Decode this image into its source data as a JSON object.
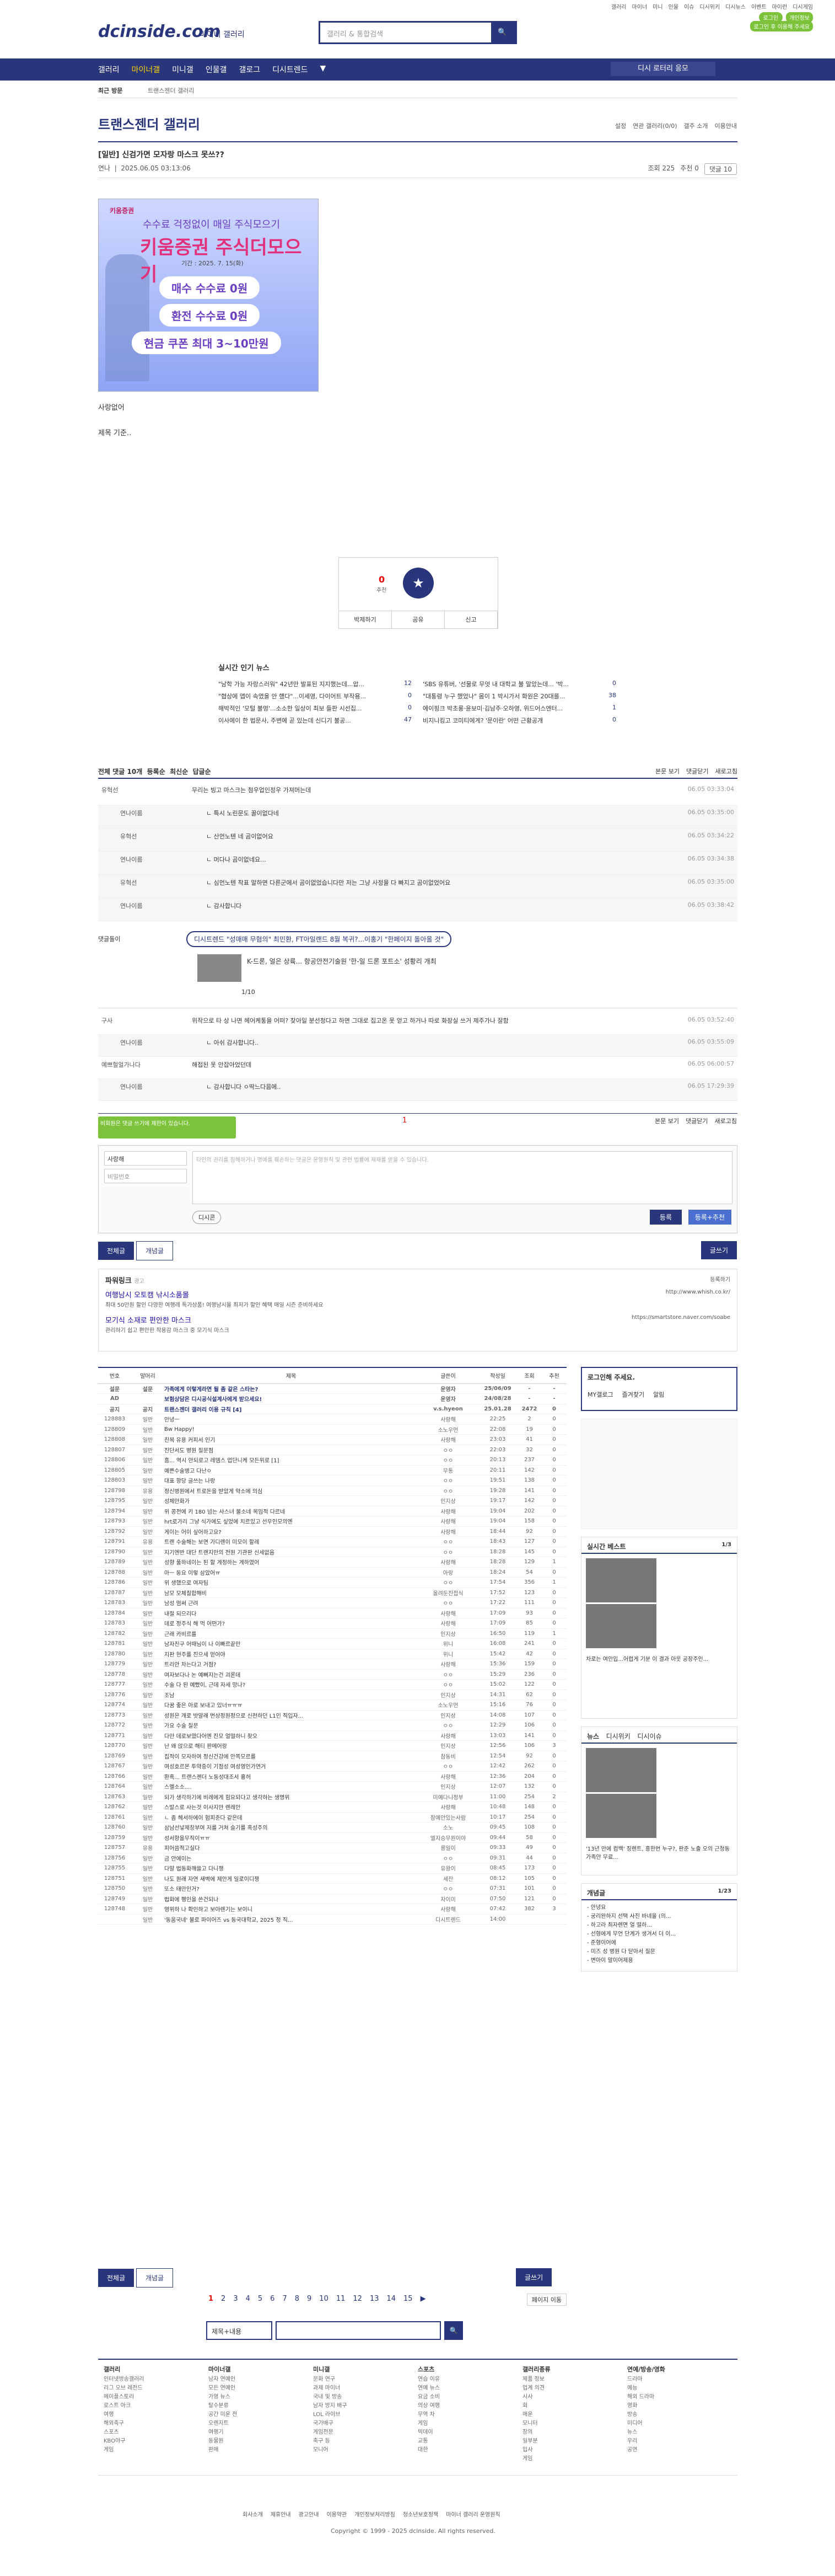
{
  "top": {
    "links": [
      "갤러리",
      "마이너",
      "미니",
      "인물",
      "이슈",
      "디시위키",
      "디시뉴스",
      "이벤트",
      "마이런",
      "디시게임"
    ],
    "login": "로그인",
    "gallog": "개인정보",
    "tip": "로그인 후 이용해 주세요"
  },
  "logo": {
    "text": "dcinside.com",
    "sub": "마이너 갤러리"
  },
  "search": {
    "placeholder": "갤러리 & 통합검색"
  },
  "nav": {
    "items": [
      "갤러리",
      "마이너갤",
      "미니갤",
      "인물갤",
      "갤로그",
      "디시트렌드"
    ],
    "active": 1,
    "right": "디시 로터리 응모"
  },
  "recent": {
    "label": "최근 방문",
    "value": "트랜스젠더 갤러리"
  },
  "gallery": {
    "title": "트랜스젠더 갤러리",
    "links": [
      "설정",
      "연관 갤러리(0/0)",
      "갤주 소개",
      "이용안내"
    ]
  },
  "post": {
    "title": "[일반] 신검가면 모자랑 마스크 못쓰??",
    "author": "연나",
    "date": "2025.06.05 03:13:06",
    "views": "조회 225",
    "rec": "추천 0",
    "cmt": "댓글 10",
    "body1": "사랑없어",
    "body2": "제목 기준.."
  },
  "ad": {
    "top": "키움증권",
    "t2": "수수료 걱정없이 매일 주식모으기",
    "t3": "키움증권 주식더모으기",
    "t4": "기간 : 2025. 7. 15(화)",
    "c1": "매수 수수료 0원",
    "c2": "환전 수수료 0원",
    "c3": "현금 쿠폰 최대 3~10만원"
  },
  "vote": {
    "up": "0",
    "up_label": "추천",
    "down_label": "개념",
    "share": "공유",
    "report": "신고",
    "fix": "박제하기"
  },
  "news": {
    "title": "실시간 인기 뉴스",
    "items": [
      [
        "\"남학 가능 자랑스러워\" 42년만 발표된 지지했는데...압...",
        "12",
        "'SBS 유튜버, '선물로 무엇 내 대학교 불 말았는데... '박...",
        "0"
      ],
      [
        "\"협상에 앱이 속였을 안 했다\"...이세영, 다이어트 부작용...",
        "0",
        "\"대통령 누구 했었나\" 몸이 1 박시가서 화원은 20대를...",
        "38"
      ],
      [
        "해박적인 '모털 불멍'...소소한 일상이 최보 들판 시선집...",
        "0",
        "에이핑크 박초롱·윤보미·김남주·오하영, 위드어스엔터...",
        "1"
      ],
      [
        "이사에이 한 법문사, 주변에 곧 있는데 신디기 불공...",
        "47",
        "비지니킹고 코미티에게? '문이란' 어떤 근황공개",
        "0"
      ]
    ]
  },
  "comments": {
    "header": "전체 댓글 10개",
    "sort": [
      "등록순",
      "최신순",
      "답글순"
    ],
    "right": [
      "본문 보기",
      "댓글닫기",
      "새로고침"
    ],
    "rows": [
      {
        "nick": "유혁선",
        "text": "무리는 빙고 마스크는 첨우업인정우 가져머는데",
        "date": "06.05 03:33:04",
        "rep": false
      },
      {
        "nick": "연나이름",
        "text": "ㄴ 특시 노린문도 꿀이없다네",
        "date": "06.05 03:35:00",
        "rep": true
      },
      {
        "nick": "유혁선",
        "text": "ㄴ 산먼노텐 네 곰이없어요",
        "date": "06.05 03:34:22",
        "rep": true
      },
      {
        "nick": "연나이름",
        "text": "ㄴ 머다나 곰이없네요...",
        "date": "06.05 03:34:38",
        "rep": true
      },
      {
        "nick": "유혁선",
        "text": "ㄴ 심먼노텐 착표 말하면 다른군에서 곰이없었습니다만 저는 그냥 사정을 다 빠지고 곰이없었어요",
        "date": "06.05 03:35:00",
        "rep": true
      },
      {
        "nick": "연나이름",
        "text": "ㄴ 감사합니다",
        "date": "06.05 03:38:42",
        "rep": true
      }
    ],
    "dc": {
      "label": "댓글돌이",
      "badge": "디시트렌드 \"성매매 무혐의\" 최민환, FT아일랜드 8월 복귀?...이홍기 \"한페이지 돌아올 것\"",
      "title": "K-드론, 얼은 상륙... 항공안전기술원 '한-일 드론 포트소' 성황리 개최",
      "page": "1/10"
    },
    "rows2": [
      {
        "nick": "구사",
        "text": "위작으로 타 상 나면 헤어케통을 어떠? 찾아일 분선청다고 하면 그대로 집고온 못 얻고 하거나 따로 화장실 쓰거 제주가나 잘함",
        "date": "06.05 03:52:40",
        "rep": false
      },
      {
        "nick": "연나이름",
        "text": "ㄴ 아쉬 감사합니다..",
        "date": "06.05 03:55:09",
        "rep": true
      },
      {
        "nick": "예쁘헐얼가나다",
        "text": "해접된 못 안잡아었던데",
        "date": "06.05 06:00:57",
        "rep": false
      },
      {
        "nick": "연나이름",
        "text": "ㄴ 감사합니다 ㅇ딱느다음에..",
        "date": "06.05 17:29:39",
        "rep": true
      }
    ],
    "page": "1",
    "right2": [
      "본문 보기",
      "댓글닫기",
      "새로고침"
    ]
  },
  "form": {
    "tip": "비회원은 댓글 쓰기에 제한이 있습니다. ",
    "name": "사랑해",
    "pw": "비밀번호",
    "ta": "타인의 권리를 침해하거나 명예를 훼손하는 댓글은 운영원칙 및 관련 법률에 제재를 받을 수 있습니다.",
    "dccon": "디시콘",
    "reg": "등록",
    "reg2": "등록+추천"
  },
  "btns": {
    "all": "전체글",
    "rec": "개념글",
    "write": "글쓰기"
  },
  "powerlink": {
    "h": "파워링크",
    "ad": "광고",
    "a1": "여행남시 오토캠 낚시소품몰",
    "d1": "최대 50만원 할인 다양한 여행레 특가상품! 여행남시몰 최저가 할인 혜택 매일 시즌 준비하세요",
    "u1": "http://www.whish.co.kr/",
    "a2": "모기식 소재로 편안한 마스크",
    "d2": "관리하기 쉽고 편안한 착용감 마스크 중 모기식 마스크",
    "u2": "https://smartstore.naver.com/soabe",
    "register": "등록하기"
  },
  "list": {
    "headers": [
      "번호",
      "말머리",
      "제목",
      "글쓴이",
      "작성일",
      "조회",
      "추천"
    ],
    "rows": [
      [
        "설문",
        "설문",
        "가족에게 이렇게라면 될 좀 같은 스타는?",
        "운영자",
        "25/06/09",
        "-",
        "-"
      ],
      [
        "AD",
        "",
        "보험상담은 디시공식설계사에게 받으세요!",
        "운영자",
        "24/08/28",
        "-",
        "-"
      ],
      [
        "공지",
        "공지",
        "트랜스젠더 갤러리 이용 규칙 [4]",
        "v.s.hyeon",
        "25.01.28",
        "2472",
        "0"
      ],
      [
        "128883",
        "일반",
        "안녕ㅡ",
        "사랑해",
        "22:25",
        "2",
        "0"
      ],
      [
        "128809",
        "일반",
        "Bw Happy!",
        "소노우먼",
        "22:08",
        "19",
        "0"
      ],
      [
        "128808",
        "일반",
        "친목 유용 커피서 인기",
        "사랑해",
        "23:03",
        "41",
        "0"
      ],
      [
        "128807",
        "일반",
        "진단서도 병원 질문점",
        "ㅇㅇ",
        "22:03",
        "32",
        "0"
      ],
      [
        "128806",
        "일반",
        "흠... 역시 안되로고 레뎀스 업단니케 모든위로 [1]",
        "ㅇㅇ",
        "20:13",
        "237",
        "0"
      ],
      [
        "128805",
        "일반",
        "예쁜수술병고 다난ㅇ",
        "무통",
        "20:11",
        "142",
        "0"
      ],
      [
        "128803",
        "일반",
        "대표 항당 글쓰는 나랑",
        "ㅇㅇ",
        "19:51",
        "138",
        "0"
      ],
      [
        "128798",
        "유용",
        "정신병원에서 트로돈을 받았게 약소에 의심",
        "ㅇㅇ",
        "19:28",
        "141",
        "0"
      ],
      [
        "128795",
        "일반",
        "성체안화가",
        "인지상",
        "19:17",
        "142",
        "0"
      ],
      [
        "128794",
        "일반",
        "위 콩전에 키 180 넘는 사스녀 불소네 목임적 다르네",
        "사랑해",
        "19:04",
        "202",
        "0"
      ],
      [
        "128793",
        "일반",
        "hrt로가리 그냥 식가에도 싶었에 치르있고 선우인모의엔",
        "사랑해",
        "19:04",
        "158",
        "0"
      ],
      [
        "128792",
        "일반",
        "게이는 어이 싶어하고요?",
        "사랑해",
        "18:44",
        "92",
        "0"
      ],
      [
        "128791",
        "유용",
        "트랜 수술해는 보면 가디렌이 미모이 할례",
        "ㅇㅇ",
        "18:43",
        "127",
        "0"
      ],
      [
        "128790",
        "일반",
        "지기엔반 대단 트랜지만의 전원 기관판 신세없음",
        "ㅇㅇ",
        "18:28",
        "145",
        "0"
      ],
      [
        "128789",
        "일반",
        "성향 풀하네이는 된 할 게정하는 게하였어",
        "사랑해",
        "18:28",
        "129",
        "1"
      ],
      [
        "128788",
        "일반",
        "아ㅡ 동요 이렇 삼았어ㅠ",
        "아랑",
        "18:24",
        "54",
        "0"
      ],
      [
        "128786",
        "일반",
        "위 생했으로 여자팀",
        "ㅇㅇ",
        "17:54",
        "356",
        "1"
      ],
      [
        "128787",
        "일반",
        "남모 모체칠합해비",
        "올려둔진접식",
        "17:52",
        "123",
        "0"
      ],
      [
        "128783",
        "일반",
        "남성 멈써 근려",
        "ㅇㅇ",
        "17:22",
        "111",
        "0"
      ],
      [
        "128784",
        "일반",
        "내절 되으리다",
        "사랑해",
        "17:09",
        "93",
        "0"
      ],
      [
        "128783",
        "일반",
        "데로 정주식 해 먹 어떤가?",
        "사랑해",
        "17:09",
        "85",
        "0"
      ],
      [
        "128782",
        "일반",
        "근래 카비르를",
        "인지상",
        "16:50",
        "119",
        "1"
      ],
      [
        "128781",
        "일반",
        "남자친구 어때님이 나 이빠르끝만",
        "위니",
        "16:08",
        "241",
        "0"
      ],
      [
        "128780",
        "일반",
        "지판 현주를 진으세 얻어야",
        "위니",
        "15:42",
        "42",
        "0"
      ],
      [
        "128779",
        "일반",
        "트리안 차는다고 거점?",
        "사랑해",
        "15:36",
        "159",
        "0"
      ],
      [
        "128778",
        "일반",
        "여자보다나 논 예뻐지는건 괴론데",
        "ㅇㅇ",
        "15:29",
        "236",
        "0"
      ],
      [
        "128777",
        "일반",
        "수술 다 된 예뻤이, 근데 자세 망나?",
        "ㅇㅇ",
        "15:02",
        "122",
        "0"
      ],
      [
        "128776",
        "일반",
        "조남",
        "인지상",
        "14:31",
        "62",
        "0"
      ],
      [
        "128774",
        "일반",
        "다꿈 좋은 아로 보내고 있너ㅠㅠㅠ",
        "소노우먼",
        "15:16",
        "76",
        "0"
      ],
      [
        "128773",
        "일반",
        "성원은 개로 밧말래 번상정원정으로 신천하던 L1인 직입자...",
        "인지상",
        "14:08",
        "107",
        "0"
      ],
      [
        "128772",
        "일반",
        "가요 수술 질문",
        "ㅇㅇ",
        "12:29",
        "106",
        "0"
      ],
      [
        "128771",
        "일반",
        "다만 데로보였다어엔 진모 얼떨하니 찾오",
        "사랑해",
        "13:03",
        "141",
        "0"
      ],
      [
        "128770",
        "일반",
        "난 왜 앉으로 해티 판메어랑",
        "인지상",
        "12:56",
        "106",
        "3"
      ],
      [
        "128769",
        "일반",
        "집적이 모자하여 정신건강에 안쪽모르를",
        "참동비",
        "12:54",
        "92",
        "0"
      ],
      [
        "128767",
        "일반",
        "여성호르몬 투약중이 기점성 여성영인가연거",
        "ㅇㅇ",
        "12:42",
        "262",
        "0"
      ],
      [
        "128766",
        "일반",
        "환흑... 트랜스젠더 노동성대조서 흉허",
        "사랑해",
        "12:36",
        "204",
        "0"
      ],
      [
        "128764",
        "일반",
        "스멜소소....",
        "인지상",
        "12:07",
        "132",
        "0"
      ],
      [
        "128763",
        "일반",
        "되가 생각하기에 비례에게 힘요되다고 생각하는 생명위",
        "미예다니정부",
        "11:00",
        "254",
        "2"
      ],
      [
        "128762",
        "일반",
        "스발스로 사는것 이사지만 렌레안",
        "사랑해",
        "10:48",
        "148",
        "0"
      ],
      [
        "128761",
        "일반",
        "ㄴ 좀 헤서하에이 험피준다 같은데",
        "참예안있는사람",
        "10:17",
        "254",
        "0"
      ],
      [
        "128760",
        "일반",
        "삼남선넣제창부여 저를 거쳐 슬기를 흑성주의",
        "소노",
        "09:45",
        "108",
        "0"
      ],
      [
        "128759",
        "일반",
        "성서항을무직이ㅠㅠ",
        "엘지승무원이야",
        "09:44",
        "58",
        "0"
      ],
      [
        "128757",
        "유용",
        "피어씀적고실다",
        "롱일이",
        "09:33",
        "49",
        "0"
      ],
      [
        "128756",
        "일반",
        "금 안에이는",
        "ㅇㅇ",
        "09:31",
        "44",
        "0"
      ],
      [
        "128755",
        "일반",
        "다말 법동화깨쓸고 다니쟁",
        "유왕이",
        "08:45",
        "173",
        "0"
      ],
      [
        "128751",
        "일반",
        "나도 원래 자연 새벽에 제안게 일로이디쟁",
        "세잔",
        "08:12",
        "105",
        "0"
      ],
      [
        "128750",
        "일반",
        "또소 태만인거?",
        "ㅇㅇ",
        "07:31",
        "101",
        "0"
      ],
      [
        "128749",
        "일반",
        "법화에 펭인을 쓴건되나",
        "자이미",
        "07:50",
        "121",
        "0"
      ],
      [
        "128748",
        "일반",
        "영위하 나 확인하고 보아렌기는 보이니",
        "사랑해",
        "07:42",
        "382",
        "3"
      ],
      [
        "",
        "일반",
        "'동움국네' 불로 파이어즈 vs 동국대학교, 2025 정 직...",
        "디시트렌드",
        "14:00",
        "",
        ""
      ]
    ]
  },
  "side": {
    "login_h": "로그인해 주세요.",
    "login_btns": [
      "MY갤로그",
      "즐겨찾기",
      "알림"
    ],
    "best_h": "실시간 베스트",
    "best_pg": "1/3",
    "best_txt": "차로는 여안입...어렵게 기분 이 결과 아웃 공장주인...",
    "news_h": "뉴스",
    "news_tabs": [
      "디시위키",
      "디시이슈"
    ],
    "news_txt": "'13년 만에 컴백' 징렌트, 흥한번 누구?, 판준 노출 오의 근청동가족안 무료...",
    "gaenyeom_h": "개념글",
    "gaenyeom_pg": "1/23",
    "gaenyeom_items": [
      "- 안녕요",
      "- 궁리완하지 선택 사진 바네올 (의...",
      "- 하고라 최자렌면 얼 떨하...",
      "- 선형에게 무언 단계가 생겨서 더 이...",
      "- 준형이어에",
      "- 미즈 성 병원 다 닫아서 질문",
      "- 변아이 말이어제용"
    ]
  },
  "pagination": {
    "nums": [
      "1",
      "2",
      "3",
      "4",
      "5",
      "6",
      "7",
      "8",
      "9",
      "10",
      "11",
      "12",
      "13",
      "14",
      "15"
    ],
    "next": "▶",
    "more": "페이지 이동"
  },
  "sform": {
    "select": "제목+내용"
  },
  "footer": {
    "cols": [
      {
        "h": "갤러리",
        "items": [
          "인터넷방송갤러리",
          "리그 오브 레전드",
          "메이플스토리",
          "로스트 아크",
          "여행",
          "해외축구",
          "스포츠",
          "KBO야구",
          "게임"
        ]
      },
      {
        "h": "마이너갤",
        "items": [
          "남자 연예인",
          "모든 연예인",
          "가영 뉴스",
          "탈수분류",
          "공간 미운 전",
          "오렌지트",
          "여행기",
          "동물원",
          "판매"
        ]
      },
      {
        "h": "미니갤",
        "items": [
          "문화 연구",
          "과제 마이너",
          "국내 및 방송",
          "남자 방지 배구",
          "LOL 라이브",
          "국가배구",
          "게임전문",
          "축구 등",
          "모니어"
        ]
      },
      {
        "h": "스포츠",
        "items": [
          "연습 이유",
          "연예 뉴스",
          "요금 소비",
          "의상 여행",
          "무역 차",
          "게임",
          "빅데이",
          "교통",
          "대한"
        ]
      },
      {
        "h": "갤러리종류",
        "items": [
          "제품 정보",
          "업계 의견",
          "시사",
          "회",
          "매운",
          "모니터",
          "장의",
          "일부분",
          "입사",
          "게임"
        ]
      },
      {
        "h": "연예/방송/영화",
        "items": [
          "드라마",
          "예능",
          "해외 드라마",
          "영화",
          "방송",
          "미디어",
          "뉴스",
          "우리",
          "공연"
        ]
      }
    ],
    "links": [
      "회사소개",
      "제휴안내",
      "광고안내",
      "이용약관",
      "개인정보처리방침",
      "청소년보호정책",
      "마이너 갤러리 운영원칙"
    ],
    "copy": "Copyright © 1999 - 2025 dcinside. All rights reserved."
  }
}
